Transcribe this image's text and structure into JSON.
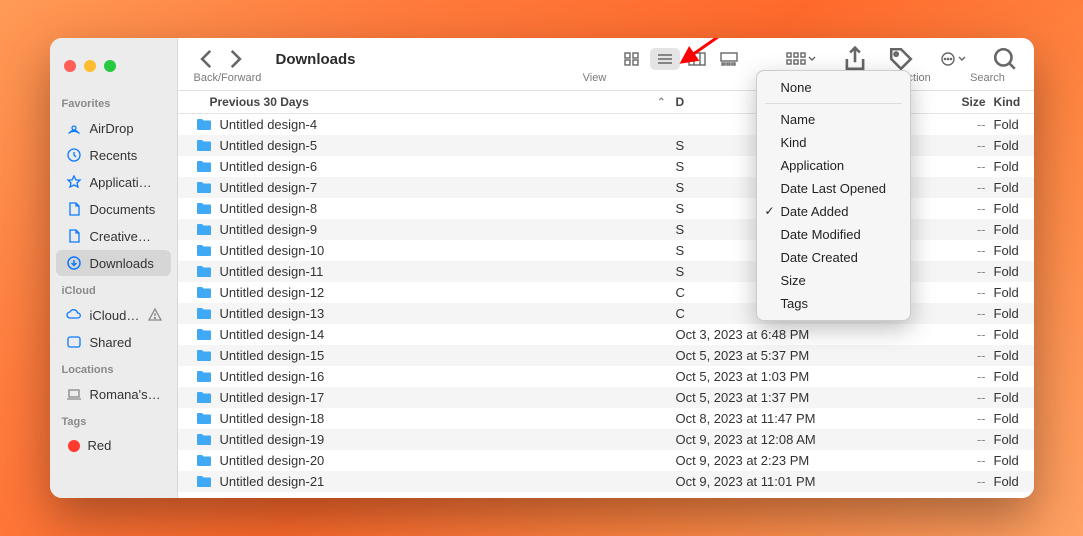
{
  "window_title": "Downloads",
  "toolbar_labels": {
    "back_forward": "Back/Forward",
    "view": "View",
    "action": "Action",
    "search": "Search"
  },
  "sidebar": {
    "favorites_label": "Favorites",
    "favorites": [
      {
        "icon": "airdrop",
        "label": "AirDrop"
      },
      {
        "icon": "recents",
        "label": "Recents"
      },
      {
        "icon": "apps",
        "label": "Applicati…"
      },
      {
        "icon": "doc",
        "label": "Documents"
      },
      {
        "icon": "doc",
        "label": "Creative…"
      },
      {
        "icon": "download",
        "label": "Downloads",
        "selected": true
      }
    ],
    "icloud_label": "iCloud",
    "icloud": [
      {
        "icon": "cloud",
        "label": "iCloud…",
        "warn": true
      },
      {
        "icon": "shared",
        "label": "Shared"
      }
    ],
    "locations_label": "Locations",
    "locations": [
      {
        "icon": "laptop",
        "label": "Romana's…"
      }
    ],
    "tags_label": "Tags",
    "tags": [
      {
        "color": "red",
        "label": "Red"
      }
    ]
  },
  "columns": {
    "name": "Previous 30 Days",
    "date": "D",
    "size": "Size",
    "kind": "Kind"
  },
  "group_menu": {
    "none": "None",
    "items": [
      "Name",
      "Kind",
      "Application",
      "Date Last Opened",
      "Date Added",
      "Date Modified",
      "Date Created",
      "Size",
      "Tags"
    ],
    "selected": "Date Added"
  },
  "files": [
    {
      "name": "Untitled design-4",
      "date": "",
      "size": "--",
      "kind": "Fold"
    },
    {
      "name": "Untitled design-5",
      "date": "S",
      "size": "--",
      "kind": "Fold"
    },
    {
      "name": "Untitled design-6",
      "date": "S",
      "size": "--",
      "kind": "Fold"
    },
    {
      "name": "Untitled design-7",
      "date": "S",
      "size": "--",
      "kind": "Fold"
    },
    {
      "name": "Untitled design-8",
      "date": "S",
      "size": "--",
      "kind": "Fold"
    },
    {
      "name": "Untitled design-9",
      "date": "S",
      "size": "--",
      "kind": "Fold"
    },
    {
      "name": "Untitled design-10",
      "date": "S",
      "size": "--",
      "kind": "Fold"
    },
    {
      "name": "Untitled design-11",
      "date": "S",
      "size": "--",
      "kind": "Fold"
    },
    {
      "name": "Untitled design-12",
      "date": "C",
      "size": "--",
      "kind": "Fold"
    },
    {
      "name": "Untitled design-13",
      "date": "C",
      "size": "--",
      "kind": "Fold"
    },
    {
      "name": "Untitled design-14",
      "date": "Oct 3, 2023 at 6:48 PM",
      "size": "--",
      "kind": "Fold"
    },
    {
      "name": "Untitled design-15",
      "date": "Oct 5, 2023 at 5:37 PM",
      "size": "--",
      "kind": "Fold"
    },
    {
      "name": "Untitled design-16",
      "date": "Oct 5, 2023 at 1:03 PM",
      "size": "--",
      "kind": "Fold"
    },
    {
      "name": "Untitled design-17",
      "date": "Oct 5, 2023 at 1:37 PM",
      "size": "--",
      "kind": "Fold"
    },
    {
      "name": "Untitled design-18",
      "date": "Oct 8, 2023 at 11:47 PM",
      "size": "--",
      "kind": "Fold"
    },
    {
      "name": "Untitled design-19",
      "date": "Oct 9, 2023 at 12:08 AM",
      "size": "--",
      "kind": "Fold"
    },
    {
      "name": "Untitled design-20",
      "date": "Oct 9, 2023 at 2:23 PM",
      "size": "--",
      "kind": "Fold"
    },
    {
      "name": "Untitled design-21",
      "date": "Oct 9, 2023 at 11:01 PM",
      "size": "--",
      "kind": "Fold"
    }
  ]
}
